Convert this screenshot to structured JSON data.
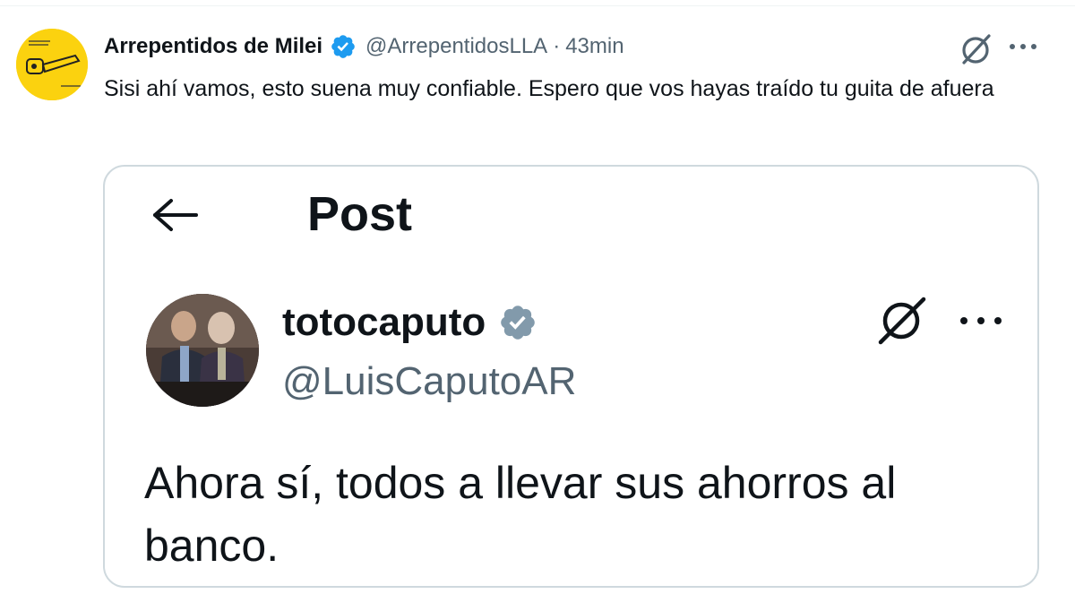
{
  "tweet": {
    "author_name": "Arrepentidos de Milei",
    "handle": "@ArrepentidosLLA",
    "separator": "·",
    "time": "43min",
    "text": "Sisi ahí vamos, esto suena muy confiable. Espero que vos hayas traído tu guita de afuera",
    "avatar_bg": "#fbd20f"
  },
  "embedded_post": {
    "header_title": "Post",
    "author_name": "totocaputo",
    "handle": "@LuisCaputoAR",
    "text": "Ahora sí, todos a llevar sus ahorros al banco."
  },
  "icons": {
    "verified_blue": "verified-badge-icon",
    "verified_gray": "verified-badge-gray-icon",
    "grok": "grok-icon",
    "more": "more-icon",
    "back": "back-arrow-icon"
  },
  "colors": {
    "text": "#0f1419",
    "secondary": "#536471",
    "verified_blue": "#1d9bf0",
    "verified_gray": "#829aab",
    "border": "#cfd9de"
  }
}
